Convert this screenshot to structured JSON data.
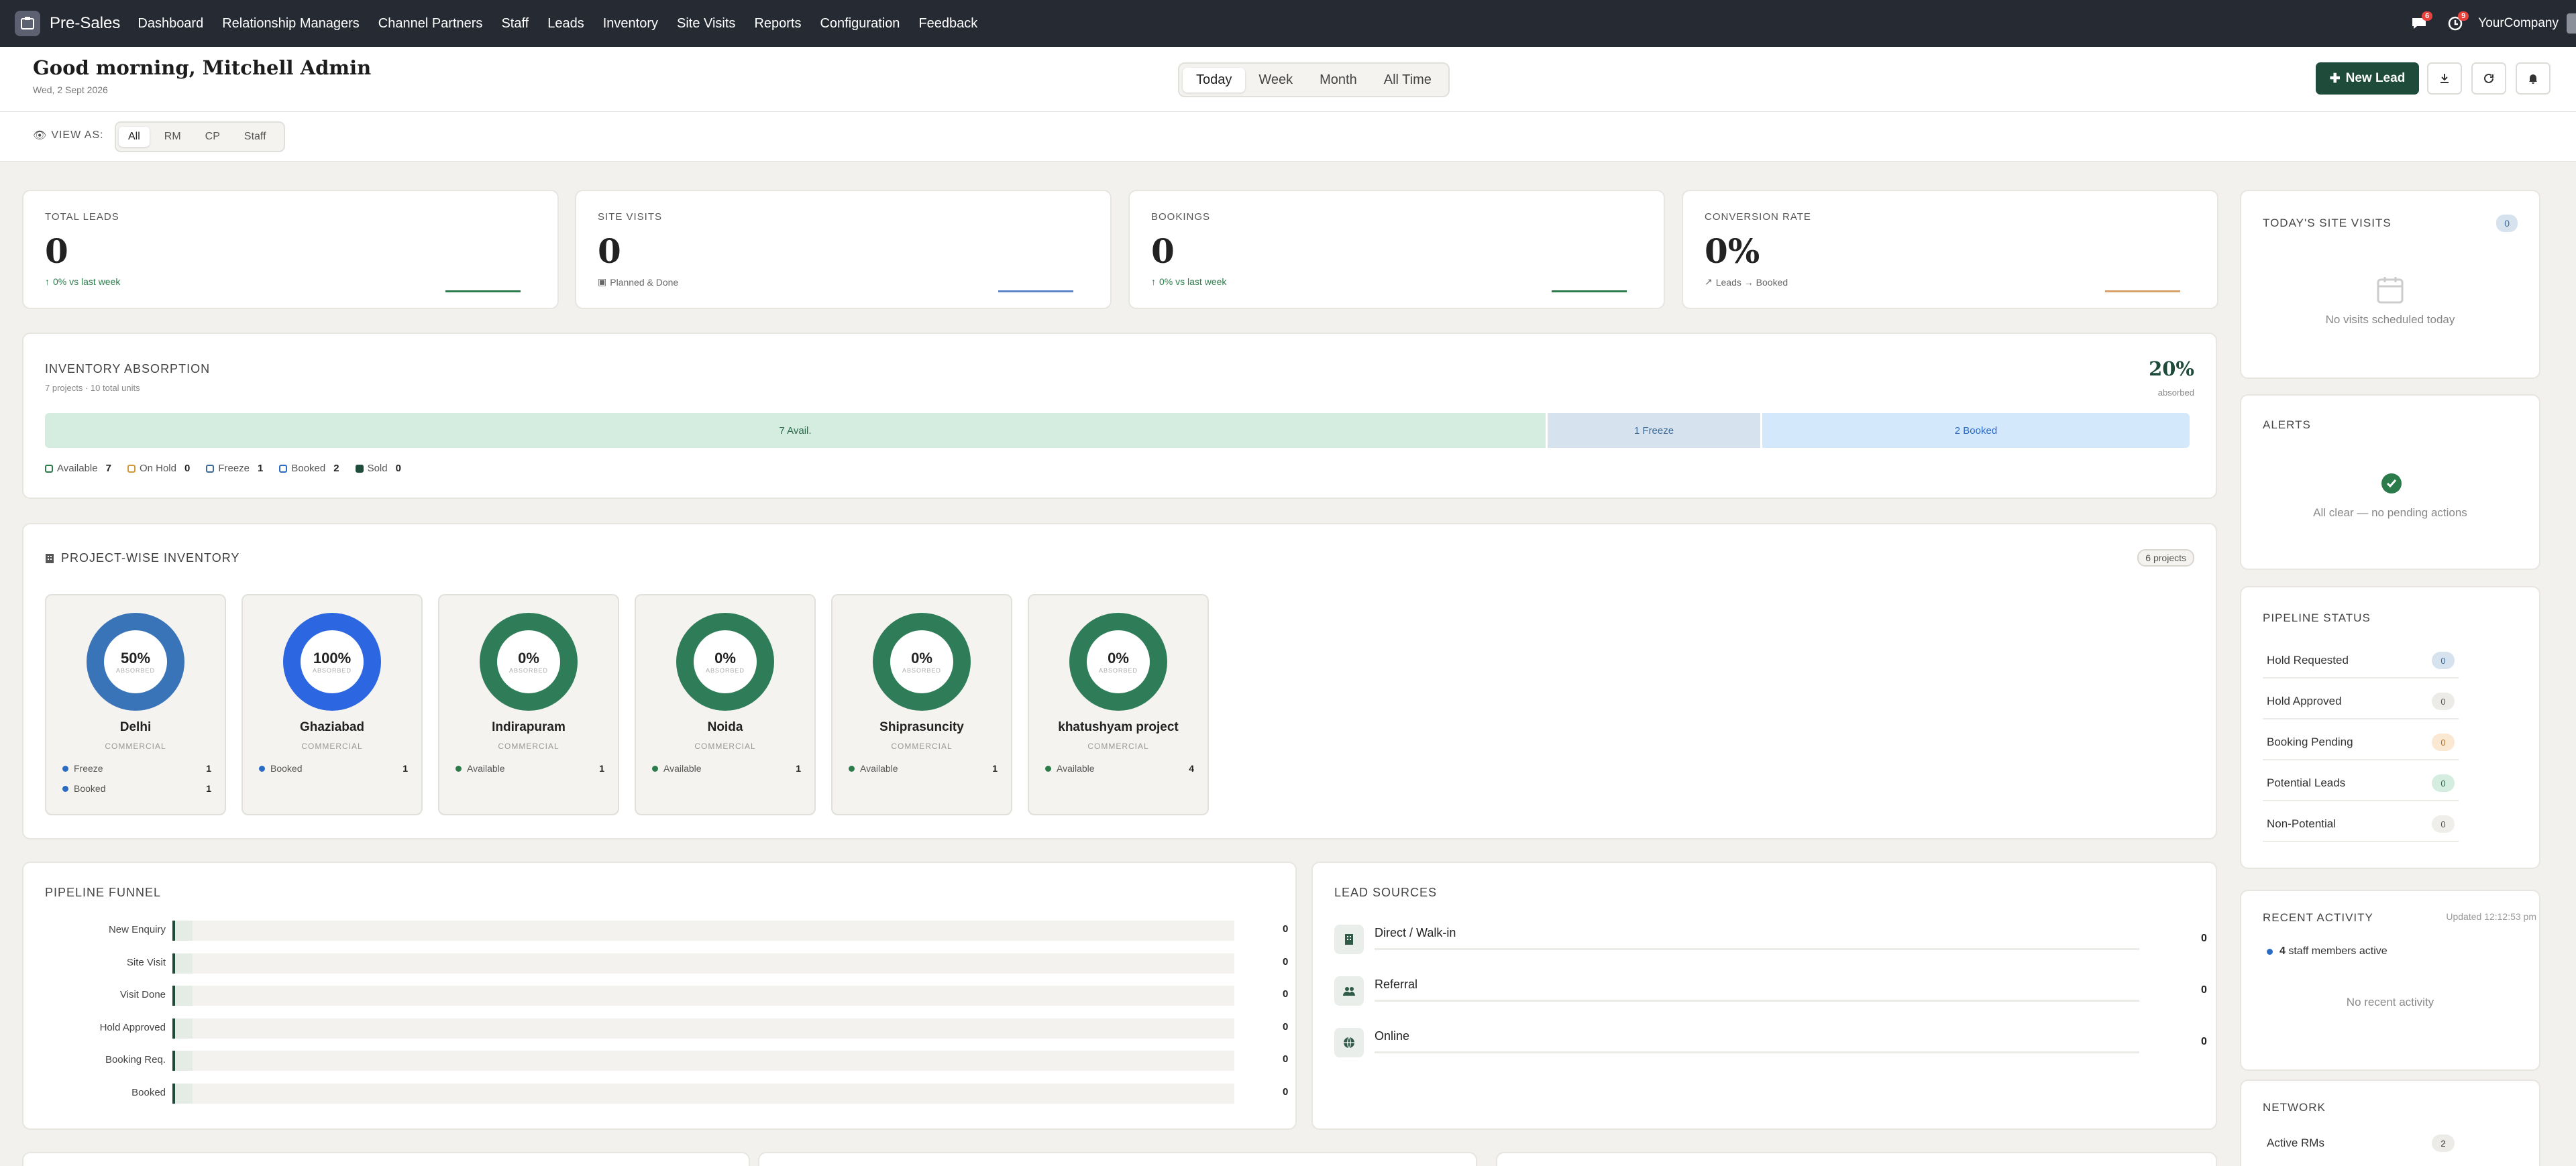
{
  "nav": {
    "brand": "Pre-Sales",
    "items": [
      "Dashboard",
      "Relationship Managers",
      "Channel Partners",
      "Staff",
      "Leads",
      "Inventory",
      "Site Visits",
      "Reports",
      "Configuration",
      "Feedback"
    ],
    "messages_count": "6",
    "activities_count": "9",
    "company": "YourCompany"
  },
  "header": {
    "greeting": "Good morning, Mitchell Admin",
    "date": "Wed, 2 Sept 2026",
    "ranges": [
      "Today",
      "Week",
      "Month",
      "All Time"
    ],
    "active_range": "Today",
    "new_lead_label": "New Lead"
  },
  "view_as": {
    "label": "VIEW AS:",
    "options": [
      "All",
      "RM",
      "CP",
      "Staff"
    ],
    "active": "All"
  },
  "kpis": [
    {
      "title": "TOTAL LEADS",
      "value": "0",
      "sub": "0% vs last week",
      "accent": "#2c7c4b"
    },
    {
      "title": "SITE VISITS",
      "value": "0",
      "sub": "Planned & Done",
      "accent": "#5b84c9"
    },
    {
      "title": "BOOKINGS",
      "value": "0",
      "sub": "0% vs last week",
      "accent": "#2c7c4b"
    },
    {
      "title": "CONVERSION RATE",
      "value": "0%",
      "sub": "Leads → Booked",
      "accent": "#d6a26a"
    }
  ],
  "inventory": {
    "title": "INVENTORY ABSORPTION",
    "subtitle": "7 projects · 10 total units",
    "absorbed_pct": "20%",
    "absorbed_label": "absorbed",
    "bars": [
      {
        "label": "7 Avail.",
        "count": 7,
        "color": "#d4ede0",
        "text_color": "#2c6b4a"
      },
      {
        "label": "1 Freeze",
        "count": 1,
        "color": "#d6e2ee",
        "text_color": "#3d6b99"
      },
      {
        "label": "2 Booked",
        "count": 2,
        "color": "#d4e8fb",
        "text_color": "#2a6bc4"
      }
    ],
    "legend": [
      {
        "label": "Available",
        "value": "7",
        "color": "#2c7c4b"
      },
      {
        "label": "On Hold",
        "value": "0",
        "color": "#d39a3a"
      },
      {
        "label": "Freeze",
        "value": "1",
        "color": "#3d6b99"
      },
      {
        "label": "Booked",
        "value": "2",
        "color": "#2a6bc4"
      },
      {
        "label": "Sold",
        "value": "0",
        "color": "#1f4b3a"
      }
    ]
  },
  "projects_section": {
    "title": "PROJECT-WISE INVENTORY",
    "badge": "6 projects",
    "projects": [
      {
        "name": "Delhi",
        "pct": "50%",
        "absorbed": 0.5,
        "ring": "#3a74b8",
        "type": "COMMERCIAL",
        "rows": [
          {
            "label": "Freeze",
            "value": "1",
            "color": "#2a6bc4"
          },
          {
            "label": "Booked",
            "value": "1",
            "color": "#2a6bc4"
          }
        ]
      },
      {
        "name": "Ghaziabad",
        "pct": "100%",
        "absorbed": 1.0,
        "ring": "#2c66e0",
        "type": "COMMERCIAL",
        "rows": [
          {
            "label": "Booked",
            "value": "1",
            "color": "#2a6bc4"
          }
        ]
      },
      {
        "name": "Indirapuram",
        "pct": "0%",
        "absorbed": 0,
        "ring": "#2e7d58",
        "type": "COMMERCIAL",
        "rows": [
          {
            "label": "Available",
            "value": "1",
            "color": "#2c7c4b"
          }
        ]
      },
      {
        "name": "Noida",
        "pct": "0%",
        "absorbed": 0,
        "ring": "#2e7d58",
        "type": "COMMERCIAL",
        "rows": [
          {
            "label": "Available",
            "value": "1",
            "color": "#2c7c4b"
          }
        ]
      },
      {
        "name": "Shiprasuncity",
        "pct": "0%",
        "absorbed": 0,
        "ring": "#2e7d58",
        "type": "COMMERCIAL",
        "rows": [
          {
            "label": "Available",
            "value": "1",
            "color": "#2c7c4b"
          }
        ]
      },
      {
        "name": "khatushyam project",
        "pct": "0%",
        "absorbed": 0,
        "ring": "#2e7d58",
        "type": "COMMERCIAL",
        "rows": [
          {
            "label": "Available",
            "value": "4",
            "color": "#2c7c4b"
          }
        ]
      }
    ],
    "absorbed_label": "ABSORBED"
  },
  "funnel": {
    "title": "PIPELINE FUNNEL",
    "stages": [
      {
        "label": "New Enquiry",
        "value": "0"
      },
      {
        "label": "Site Visit",
        "value": "0"
      },
      {
        "label": "Visit Done",
        "value": "0"
      },
      {
        "label": "Hold Approved",
        "value": "0"
      },
      {
        "label": "Booking Req.",
        "value": "0"
      },
      {
        "label": "Booked",
        "value": "0"
      }
    ]
  },
  "sources": {
    "title": "LEAD SOURCES",
    "items": [
      {
        "label": "Direct / Walk-in",
        "value": "0",
        "icon": "building-icon"
      },
      {
        "label": "Referral",
        "value": "0",
        "icon": "users-icon"
      },
      {
        "label": "Online",
        "value": "0",
        "icon": "globe-icon"
      }
    ]
  },
  "sidebar": {
    "site_visits": {
      "title": "TODAY'S SITE VISITS",
      "count": "0",
      "empty": "No visits scheduled today"
    },
    "alerts": {
      "title": "ALERTS",
      "empty": "All clear — no pending actions"
    },
    "pipeline": {
      "title": "PIPELINE STATUS",
      "items": [
        {
          "label": "Hold Requested",
          "value": "0",
          "bg": "#d6e2ee",
          "fg": "#3d6b99"
        },
        {
          "label": "Hold Approved",
          "value": "0",
          "bg": "#ecebe8",
          "fg": "#555"
        },
        {
          "label": "Booking Pending",
          "value": "0",
          "bg": "#fbe8d2",
          "fg": "#b0722c"
        },
        {
          "label": "Potential Leads",
          "value": "0",
          "bg": "#d4ede0",
          "fg": "#2c6b4a"
        },
        {
          "label": "Non-Potential",
          "value": "0",
          "bg": "#f0eeea",
          "fg": "#555"
        }
      ]
    },
    "activity": {
      "title": "RECENT ACTIVITY",
      "updated": "Updated 12:12:53 pm",
      "staff_count": "4",
      "staff_label": "staff members active",
      "empty": "No recent activity"
    },
    "network": {
      "title": "NETWORK",
      "items": [
        {
          "label": "Active RMs",
          "value": "2"
        }
      ]
    }
  }
}
